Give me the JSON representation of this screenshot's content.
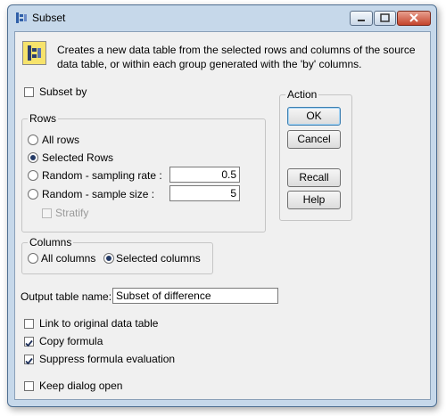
{
  "window": {
    "title": "Subset",
    "colors": {
      "frame": "#c6d8ea",
      "close": "#c4442c",
      "client": "#f0f0f0"
    }
  },
  "description": "Creates a new data table from the selected rows and columns of the source data table, or within each group generated with the 'by' columns.",
  "subset_by": {
    "label": "Subset by",
    "checked": false
  },
  "rows_group": {
    "title": "Rows",
    "all_rows": "All rows",
    "selected_rows": "Selected Rows",
    "random_rate": {
      "label": "Random - sampling rate :",
      "value": "0.5"
    },
    "random_size": {
      "label": "Random - sample size :",
      "value": "5"
    },
    "stratify": "Stratify",
    "selected": "Selected Rows"
  },
  "columns_group": {
    "title": "Columns",
    "all_columns": "All columns",
    "selected_columns": "Selected columns",
    "selected": "Selected columns"
  },
  "action_group": {
    "title": "Action",
    "ok": "OK",
    "cancel": "Cancel",
    "recall": "Recall",
    "help": "Help"
  },
  "output": {
    "label": "Output table name:",
    "value": "Subset of difference"
  },
  "options": {
    "link": {
      "label": "Link to original data table",
      "checked": false
    },
    "copy": {
      "label": "Copy formula",
      "checked": true
    },
    "suppress": {
      "label": "Suppress formula evaluation",
      "checked": true
    },
    "keep": {
      "label": "Keep dialog open",
      "checked": false
    }
  }
}
